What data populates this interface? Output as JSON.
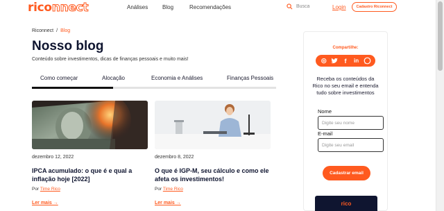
{
  "header": {
    "logo_part1": "rico",
    "logo_part2": "nnect",
    "nav": [
      "Análises",
      "Blog",
      "Recomendações"
    ],
    "search_placeholder": "Busca",
    "login_label": "Login",
    "signup_label": "Cadastro Riconnect"
  },
  "breadcrumb": {
    "home": "Riconnect",
    "separator": "/",
    "current": "Blog"
  },
  "page": {
    "title": "Nosso blog",
    "subtitle": "Conteúdo sobre investimentos, dicas de finanças pessoais e muito mais!"
  },
  "tabs": {
    "items": [
      "Como começar",
      "Alocação",
      "Economia e Análises",
      "Finanças Pessoais"
    ],
    "active_index": 0
  },
  "cards": [
    {
      "date": "dezembro 12, 2022",
      "title": "IPCA acumulado: o que é e qual a inflação hoje [2022]",
      "by": "Por",
      "author": "Time Rico",
      "more": "Ler mais →"
    },
    {
      "date": "dezembro 8, 2022",
      "title": "O que é IGP-M, seu cálculo e como ele afeta os investimentos!",
      "by": "Por",
      "author": "Time Rico",
      "more": "Ler mais →"
    }
  ],
  "sidebar": {
    "share_label": "Compartilhe:",
    "share_icons": [
      "instagram-icon",
      "twitter-icon",
      "facebook-icon",
      "linkedin-icon",
      "whatsapp-icon"
    ],
    "promo_text": "Receba os conteúdos da Rico no seu email e entenda tudo sobre investimentos",
    "name_label": "Nome",
    "name_placeholder": "Digite seu nome",
    "email_label": "E-mail",
    "email_placeholder": "Digite seu email",
    "submit_label": "Cadastrar email",
    "banner_text": "rico"
  },
  "colors": {
    "accent": "#ff5a1f",
    "navy": "#0f1530"
  }
}
